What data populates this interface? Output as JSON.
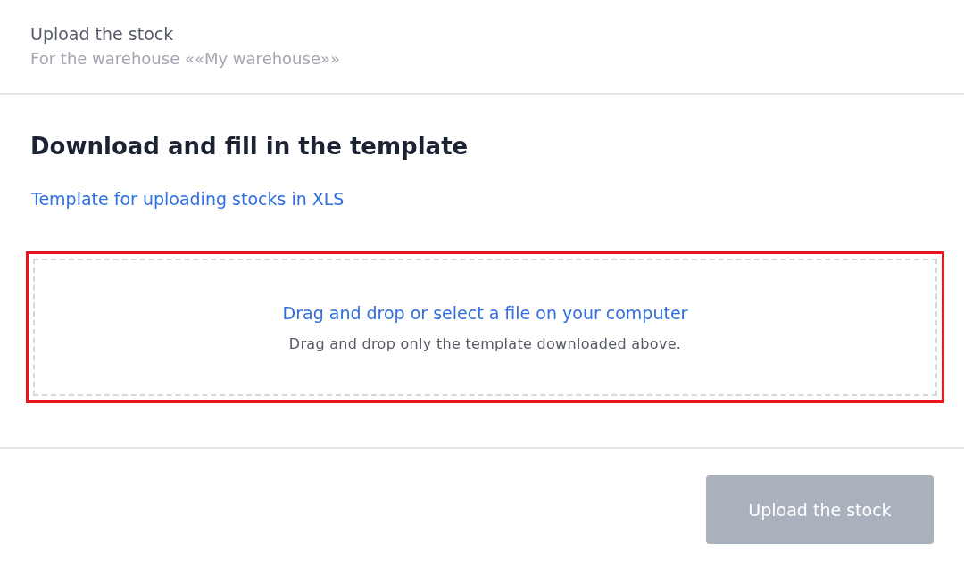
{
  "header": {
    "title": "Upload the stock",
    "subtitle": "For the warehouse ««My warehouse»»"
  },
  "section": {
    "heading": "Download and fill in the template",
    "template_link": "Template for uploading stocks in XLS"
  },
  "drop_zone": {
    "highlighted": true,
    "title": "Drag and drop or select a file on your computer",
    "hint": "Drag and drop only the template downloaded above."
  },
  "footer": {
    "upload_button": {
      "label": "Upload the stock",
      "disabled": true
    }
  }
}
